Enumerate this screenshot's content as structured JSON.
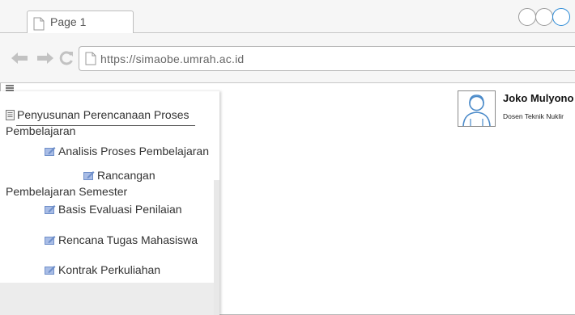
{
  "browser": {
    "tab_title": "Page 1",
    "url": "https://simaobe.umrah.ac.id",
    "icons": [
      "page-icon",
      "back-arrow-icon",
      "forward-arrow-icon",
      "reload-icon"
    ]
  },
  "sidebar": {
    "section_title": "Penyusunan Perencanaan Proses Pembelajaran",
    "items": [
      {
        "label": "Analisis Proses Pembelajaran",
        "icon": "edit-icon"
      },
      {
        "label": "Rancangan Pembelajaran Semester",
        "icon": "edit-icon"
      },
      {
        "label": "Basis Evaluasi Penilaian",
        "icon": "edit-icon"
      },
      {
        "label": "Rencana Tugas Mahasiswa",
        "icon": "edit-icon"
      },
      {
        "label": "Kontrak Perkuliahan",
        "icon": "edit-icon"
      }
    ]
  },
  "user": {
    "name": "Joko Mulyono",
    "role": "Dosen Teknik Nuklir",
    "icon": "user-avatar-icon"
  },
  "colors": {
    "chrome_bg": "#f6f6f6",
    "accent_control": "#2b8ad6",
    "icon_blue": "#6f8fc9"
  }
}
